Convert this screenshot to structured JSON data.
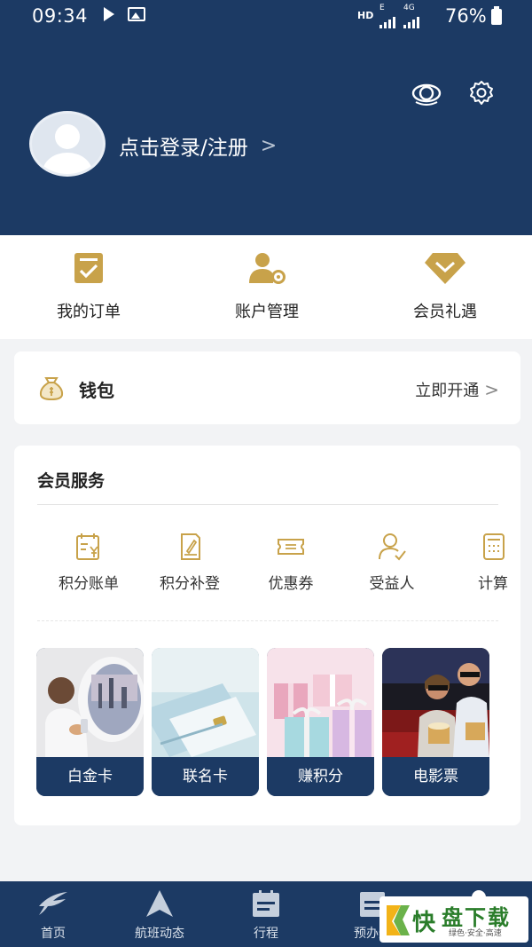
{
  "status_bar": {
    "time": "09:34",
    "hd": "HD",
    "net1": "E",
    "net2": "4G",
    "battery": "76%"
  },
  "header": {
    "login_text": "点击登录/注册",
    "chevron": ">"
  },
  "quick_menu": [
    {
      "label": "我的订单",
      "icon": "order-list-icon"
    },
    {
      "label": "账户管理",
      "icon": "account-settings-icon"
    },
    {
      "label": "会员礼遇",
      "icon": "member-diamond-icon"
    }
  ],
  "wallet": {
    "label": "钱包",
    "action": "立即开通",
    "chevron": ">"
  },
  "services": {
    "title": "会员服务",
    "items": [
      {
        "label": "积分账单",
        "icon": "points-bill-icon"
      },
      {
        "label": "积分补登",
        "icon": "points-supplement-icon"
      },
      {
        "label": "优惠券",
        "icon": "coupon-icon"
      },
      {
        "label": "受益人",
        "icon": "beneficiary-icon"
      },
      {
        "label": "计算",
        "icon": "calculator-icon"
      }
    ],
    "promos": [
      {
        "label": "白金卡"
      },
      {
        "label": "联名卡"
      },
      {
        "label": "赚积分"
      },
      {
        "label": "电影票"
      }
    ]
  },
  "bottom_nav": [
    {
      "label": "首页",
      "icon": "home-swallow-icon"
    },
    {
      "label": "航班动态",
      "icon": "flight-status-icon"
    },
    {
      "label": "行程",
      "icon": "itinerary-icon"
    },
    {
      "label": "预办登",
      "icon": "checkin-icon"
    },
    {
      "label": "",
      "icon": "profile-icon"
    }
  ],
  "watermark": {
    "logo_text": "快",
    "text": "盘下载",
    "sub": "绿色·安全·高速"
  },
  "colors": {
    "brand_navy": "#1c3a64",
    "gold": "#c8a24a",
    "background": "#f2f3f5"
  }
}
